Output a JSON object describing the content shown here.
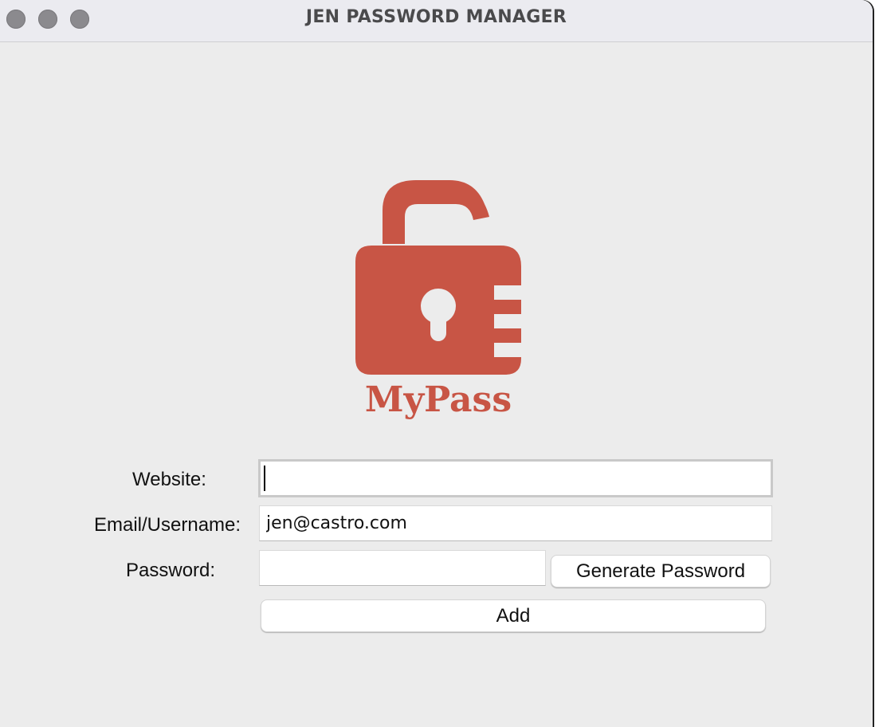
{
  "window": {
    "title": "JEN PASSWORD MANAGER"
  },
  "logo": {
    "text": "MyPass",
    "icon": "unlocked-padlock-icon",
    "color": "#c85545"
  },
  "form": {
    "website_label": "Website:",
    "website_value": "",
    "email_label": "Email/Username:",
    "email_value": "jen@castro.com",
    "password_label": "Password:",
    "password_value": "",
    "generate_button": "Generate Password",
    "add_button": "Add"
  }
}
